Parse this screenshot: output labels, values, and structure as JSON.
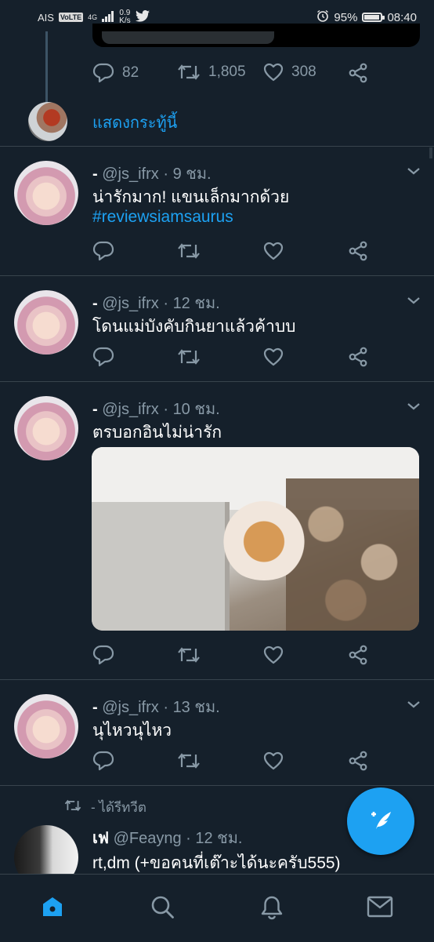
{
  "status_bar": {
    "carrier": "AIS",
    "volte": "VoLTE",
    "network": "4G",
    "speed_value": "0.9",
    "speed_unit": "K/s",
    "battery": "95%",
    "time": "08:40"
  },
  "top_tweet": {
    "replies": "82",
    "retweets": "1,805",
    "likes": "308",
    "show_thread": "แสดงกระทู้นี้"
  },
  "tweets": [
    {
      "name": "-",
      "handle": "@js_ifrx",
      "time": "9 ชม.",
      "text": "น่ารักมาก! แขนเล็กมากด้วย",
      "hashtag": "#reviewsiamsaurus"
    },
    {
      "name": "-",
      "handle": "@js_ifrx",
      "time": "12 ชม.",
      "text": "โดนแม่บังคับกินยาแล้วค้าบบ"
    },
    {
      "name": "-",
      "handle": "@js_ifrx",
      "time": "10 ชม.",
      "text": "ตรบอกอินไม่น่ารัก"
    },
    {
      "name": "-",
      "handle": "@js_ifrx",
      "time": "13 ชม.",
      "text": "นุไหวนุไหว"
    }
  ],
  "retweet_banner": "- ได้รีทวีต",
  "last_tweet": {
    "name": "เฟ",
    "handle": "@Feayng",
    "time": "12 ชม.",
    "text": "rt,dm (+ขอคนที่เต๊าะได้นะครับ555)"
  },
  "colors": {
    "background": "#15202b",
    "accent": "#1da1f2",
    "muted": "#8899a6",
    "divider": "#38444d"
  },
  "icons": [
    "reply-icon",
    "retweet-icon",
    "like-icon",
    "share-icon",
    "chevron-down-icon",
    "compose-icon",
    "home-icon",
    "search-icon",
    "bell-icon",
    "mail-icon"
  ]
}
